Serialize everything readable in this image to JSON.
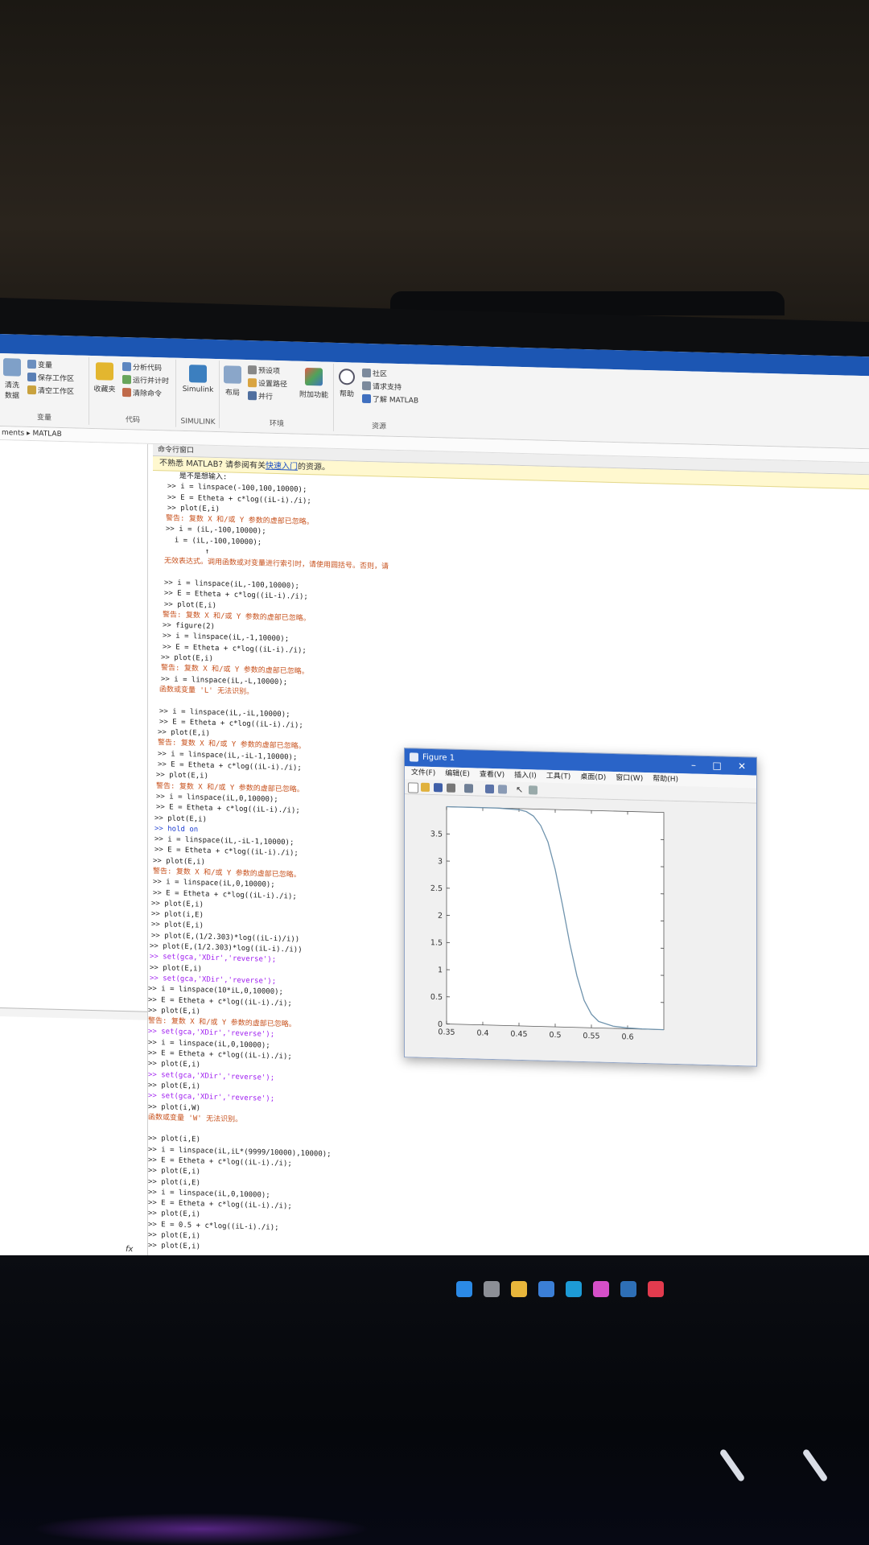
{
  "ribbon": {
    "g1": {
      "label": "",
      "items": [
        "变量",
        "保存工作区",
        "清空工作区"
      ],
      "big": "清洗\n数据"
    },
    "g1_title": "变量",
    "g2": {
      "big": "收藏夹",
      "items": [
        "分析代码",
        "运行并计时",
        "清除命令"
      ]
    },
    "g2_title": "代码",
    "g3": {
      "big": "Simulink",
      "title": "SIMULINK"
    },
    "g4": {
      "big": "布局",
      "items": [
        "预设项",
        "设置路径",
        "并行"
      ],
      "big2": "附加功能",
      "title": "环境"
    },
    "g5": {
      "big": "帮助",
      "items": [
        "社区",
        "请求支持",
        "了解 MATLAB"
      ],
      "title": "资源"
    }
  },
  "address": "ments ▸ MATLAB",
  "command_window": {
    "header": "命令行窗口",
    "banner_prefix": "不熟悉 MATLAB? 请参阅有关",
    "banner_link": "快速入门",
    "banner_suffix": "的资源。",
    "lines": [
      {
        "t": "  是不是想输入:",
        "c": "n",
        "x": 28
      },
      {
        "t": ">> i = linspace(-100,100,10000);",
        "c": "n",
        "x": 24
      },
      {
        "t": ">> E = Etheta + c*log((iL-i)./i);",
        "c": "n",
        "x": 24
      },
      {
        "t": ">> plot(E,i)",
        "c": "n",
        "x": 24
      },
      {
        "t": "警告: 复数 X 和/或 Y 参数的虚部已忽略。",
        "c": "w",
        "x": 22
      },
      {
        "t": ">> i = (iL,-100,10000);",
        "c": "n",
        "x": 22
      },
      {
        "t": "  i = (iL,-100,10000);",
        "c": "n",
        "x": 22
      },
      {
        "t": "         ↑",
        "c": "n",
        "x": 22
      },
      {
        "t": "无效表达式。调用函数或对变量进行索引时，请使用圆括号。否则，请",
        "c": "w",
        "x": 20
      },
      {
        "t": "",
        "c": "n",
        "x": 20
      },
      {
        "t": ">> i = linspace(iL,-100,10000);",
        "c": "n",
        "x": 20
      },
      {
        "t": ">> E = Etheta + c*log((iL-i)./i);",
        "c": "n",
        "x": 20
      },
      {
        "t": ">> plot(E,i)",
        "c": "n",
        "x": 20
      },
      {
        "t": "警告: 复数 X 和/或 Y 参数的虚部已忽略。",
        "c": "w",
        "x": 18
      },
      {
        "t": ">> figure(2)",
        "c": "n",
        "x": 18
      },
      {
        "t": ">> i = linspace(iL,-1,10000);",
        "c": "n",
        "x": 18
      },
      {
        "t": ">> E = Etheta + c*log((iL-i)./i);",
        "c": "n",
        "x": 18
      },
      {
        "t": ">> plot(E,i)",
        "c": "n",
        "x": 16
      },
      {
        "t": "警告: 复数 X 和/或 Y 参数的虚部已忽略。",
        "c": "w",
        "x": 16
      },
      {
        "t": ">> i = linspace(iL,-L,10000);",
        "c": "n",
        "x": 16
      },
      {
        "t": "函数或变量 'L' 无法识别。",
        "c": "w",
        "x": 14
      },
      {
        "t": "",
        "c": "n",
        "x": 14
      },
      {
        "t": ">> i = linspace(iL,-iL,10000);",
        "c": "n",
        "x": 14
      },
      {
        "t": ">> E = Etheta + c*log((iL-i)./i);",
        "c": "n",
        "x": 14
      },
      {
        "t": ">> plot(E,i)",
        "c": "n",
        "x": 12
      },
      {
        "t": "警告: 复数 X 和/或 Y 参数的虚部已忽略。",
        "c": "w",
        "x": 12
      },
      {
        "t": ">> i = linspace(iL,-iL-1,10000);",
        "c": "n",
        "x": 12
      },
      {
        "t": ">> E = Etheta + c*log((iL-i)./i);",
        "c": "n",
        "x": 12
      },
      {
        "t": ">> plot(E,i)",
        "c": "n",
        "x": 10
      },
      {
        "t": "警告: 复数 X 和/或 Y 参数的虚部已忽略。",
        "c": "w",
        "x": 10
      },
      {
        "t": ">> i = linspace(iL,0,10000);",
        "c": "n",
        "x": 10
      },
      {
        "t": ">> E = Etheta + c*log((iL-i)./i);",
        "c": "n",
        "x": 10
      },
      {
        "t": ">> plot(E,i)",
        "c": "n",
        "x": 8
      },
      {
        "t": ">> hold on",
        "c": "k",
        "x": 8
      },
      {
        "t": ">> i = linspace(iL,-iL-1,10000);",
        "c": "n",
        "x": 8
      },
      {
        "t": ">> E = Etheta + c*log((iL-i)./i);",
        "c": "n",
        "x": 8
      },
      {
        "t": ">> plot(E,i)",
        "c": "n",
        "x": 6
      },
      {
        "t": "警告: 复数 X 和/或 Y 参数的虚部已忽略。",
        "c": "w",
        "x": 6
      },
      {
        "t": ">> i = linspace(iL,0,10000);",
        "c": "n",
        "x": 6
      },
      {
        "t": ">> E = Etheta + c*log((iL-i)./i);",
        "c": "n",
        "x": 6
      },
      {
        "t": ">> plot(E,i)",
        "c": "n",
        "x": 4
      },
      {
        "t": ">> plot(i,E)",
        "c": "n",
        "x": 4
      },
      {
        "t": ">> plot(E,i)",
        "c": "n",
        "x": 4
      },
      {
        "t": ">> plot(E,(1/2.303)*log((iL-i)/i))",
        "c": "n",
        "x": 4
      },
      {
        "t": ">> plot(E,(1/2.303)*log((iL-i)./i))",
        "c": "n",
        "x": 2
      },
      {
        "t": ">> set(gca,'XDir','reverse');",
        "c": "s",
        "x": 2
      },
      {
        "t": ">> plot(E,i)",
        "c": "n",
        "x": 2
      },
      {
        "t": ">> set(gca,'XDir','reverse');",
        "c": "s",
        "x": 2
      },
      {
        "t": ">> i = linspace(10*iL,0,10000);",
        "c": "n",
        "x": 0
      },
      {
        "t": ">> E = Etheta + c*log((iL-i)./i);",
        "c": "n",
        "x": 0
      },
      {
        "t": ">> plot(E,i)",
        "c": "n",
        "x": 0
      },
      {
        "t": "警告: 复数 X 和/或 Y 参数的虚部已忽略。",
        "c": "w",
        "x": 0
      },
      {
        "t": ">> set(gca,'XDir','reverse');",
        "c": "s",
        "x": 0
      },
      {
        "t": ">> i = linspace(iL,0,10000);",
        "c": "n",
        "x": 0
      },
      {
        "t": ">> E = Etheta + c*log((iL-i)./i);",
        "c": "n",
        "x": 0
      },
      {
        "t": ">> plot(E,i)",
        "c": "n",
        "x": 0
      },
      {
        "t": ">> set(gca,'XDir','reverse');",
        "c": "s",
        "x": 0
      },
      {
        "t": ">> plot(E,i)",
        "c": "n",
        "x": 0
      },
      {
        "t": ">> set(gca,'XDir','reverse');",
        "c": "s",
        "x": 0
      },
      {
        "t": ">> plot(i,W)",
        "c": "n",
        "x": 0
      },
      {
        "t": "函数或变量 'W' 无法识别。",
        "c": "w",
        "x": 0
      },
      {
        "t": "",
        "c": "n",
        "x": 0
      },
      {
        "t": ">> plot(i,E)",
        "c": "n",
        "x": 0
      },
      {
        "t": ">> i = linspace(iL,iL*(9999/10000),10000);",
        "c": "n",
        "x": 0
      },
      {
        "t": ">> E = Etheta + c*log((iL-i)./i);",
        "c": "n",
        "x": 0
      },
      {
        "t": ">> plot(E,i)",
        "c": "n",
        "x": 0
      },
      {
        "t": ">> plot(i,E)",
        "c": "n",
        "x": 0
      },
      {
        "t": ">> i = linspace(iL,0,10000);",
        "c": "n",
        "x": 0
      },
      {
        "t": ">> E = Etheta + c*log((iL-i)./i);",
        "c": "n",
        "x": 0
      },
      {
        "t": ">> plot(E,i)",
        "c": "n",
        "x": 0
      },
      {
        "t": ">> E = 0.5 + c*log((iL-i)./i);",
        "c": "n",
        "x": 0
      },
      {
        "t": ">> plot(E,i)",
        "c": "n",
        "x": 0
      },
      {
        "t": ">> plot(E,i)",
        "c": "n",
        "x": 0
      }
    ],
    "fx": "fx"
  },
  "figure": {
    "title": "Figure 1",
    "menu": [
      "文件(F)",
      "编辑(E)",
      "查看(V)",
      "插入(I)",
      "工具(T)",
      "桌面(D)",
      "窗口(W)",
      "帮助(H)"
    ],
    "line_color": "#6f93ad"
  },
  "chart_data": {
    "type": "line",
    "title": "",
    "xlabel": "",
    "ylabel": "",
    "xlim": [
      0.35,
      0.65
    ],
    "ylim": [
      0,
      4
    ],
    "xticks": [
      "0.35",
      "0.4",
      "0.45",
      "0.5",
      "0.55",
      "0.6"
    ],
    "yticks": [
      "0",
      "0.5",
      "1",
      "1.5",
      "2",
      "2.5",
      "3",
      "3.5"
    ],
    "grid": false,
    "series": [
      {
        "x": [
          0.35,
          0.42,
          0.45,
          0.46,
          0.47,
          0.48,
          0.49,
          0.5,
          0.51,
          0.52,
          0.53,
          0.54,
          0.55,
          0.56,
          0.58,
          0.6,
          0.62,
          0.65
        ],
        "y": [
          4.0,
          4.0,
          3.98,
          3.95,
          3.87,
          3.7,
          3.4,
          2.9,
          2.25,
          1.55,
          0.95,
          0.5,
          0.25,
          0.12,
          0.04,
          0.015,
          0.005,
          0.0
        ]
      }
    ]
  },
  "taskbar": {
    "icons": [
      "windows-start-icon",
      "task-view-icon",
      "file-explorer-icon",
      "store-icon",
      "edge-icon",
      "copilot-icon",
      "matlab-icon",
      "music-icon"
    ]
  }
}
